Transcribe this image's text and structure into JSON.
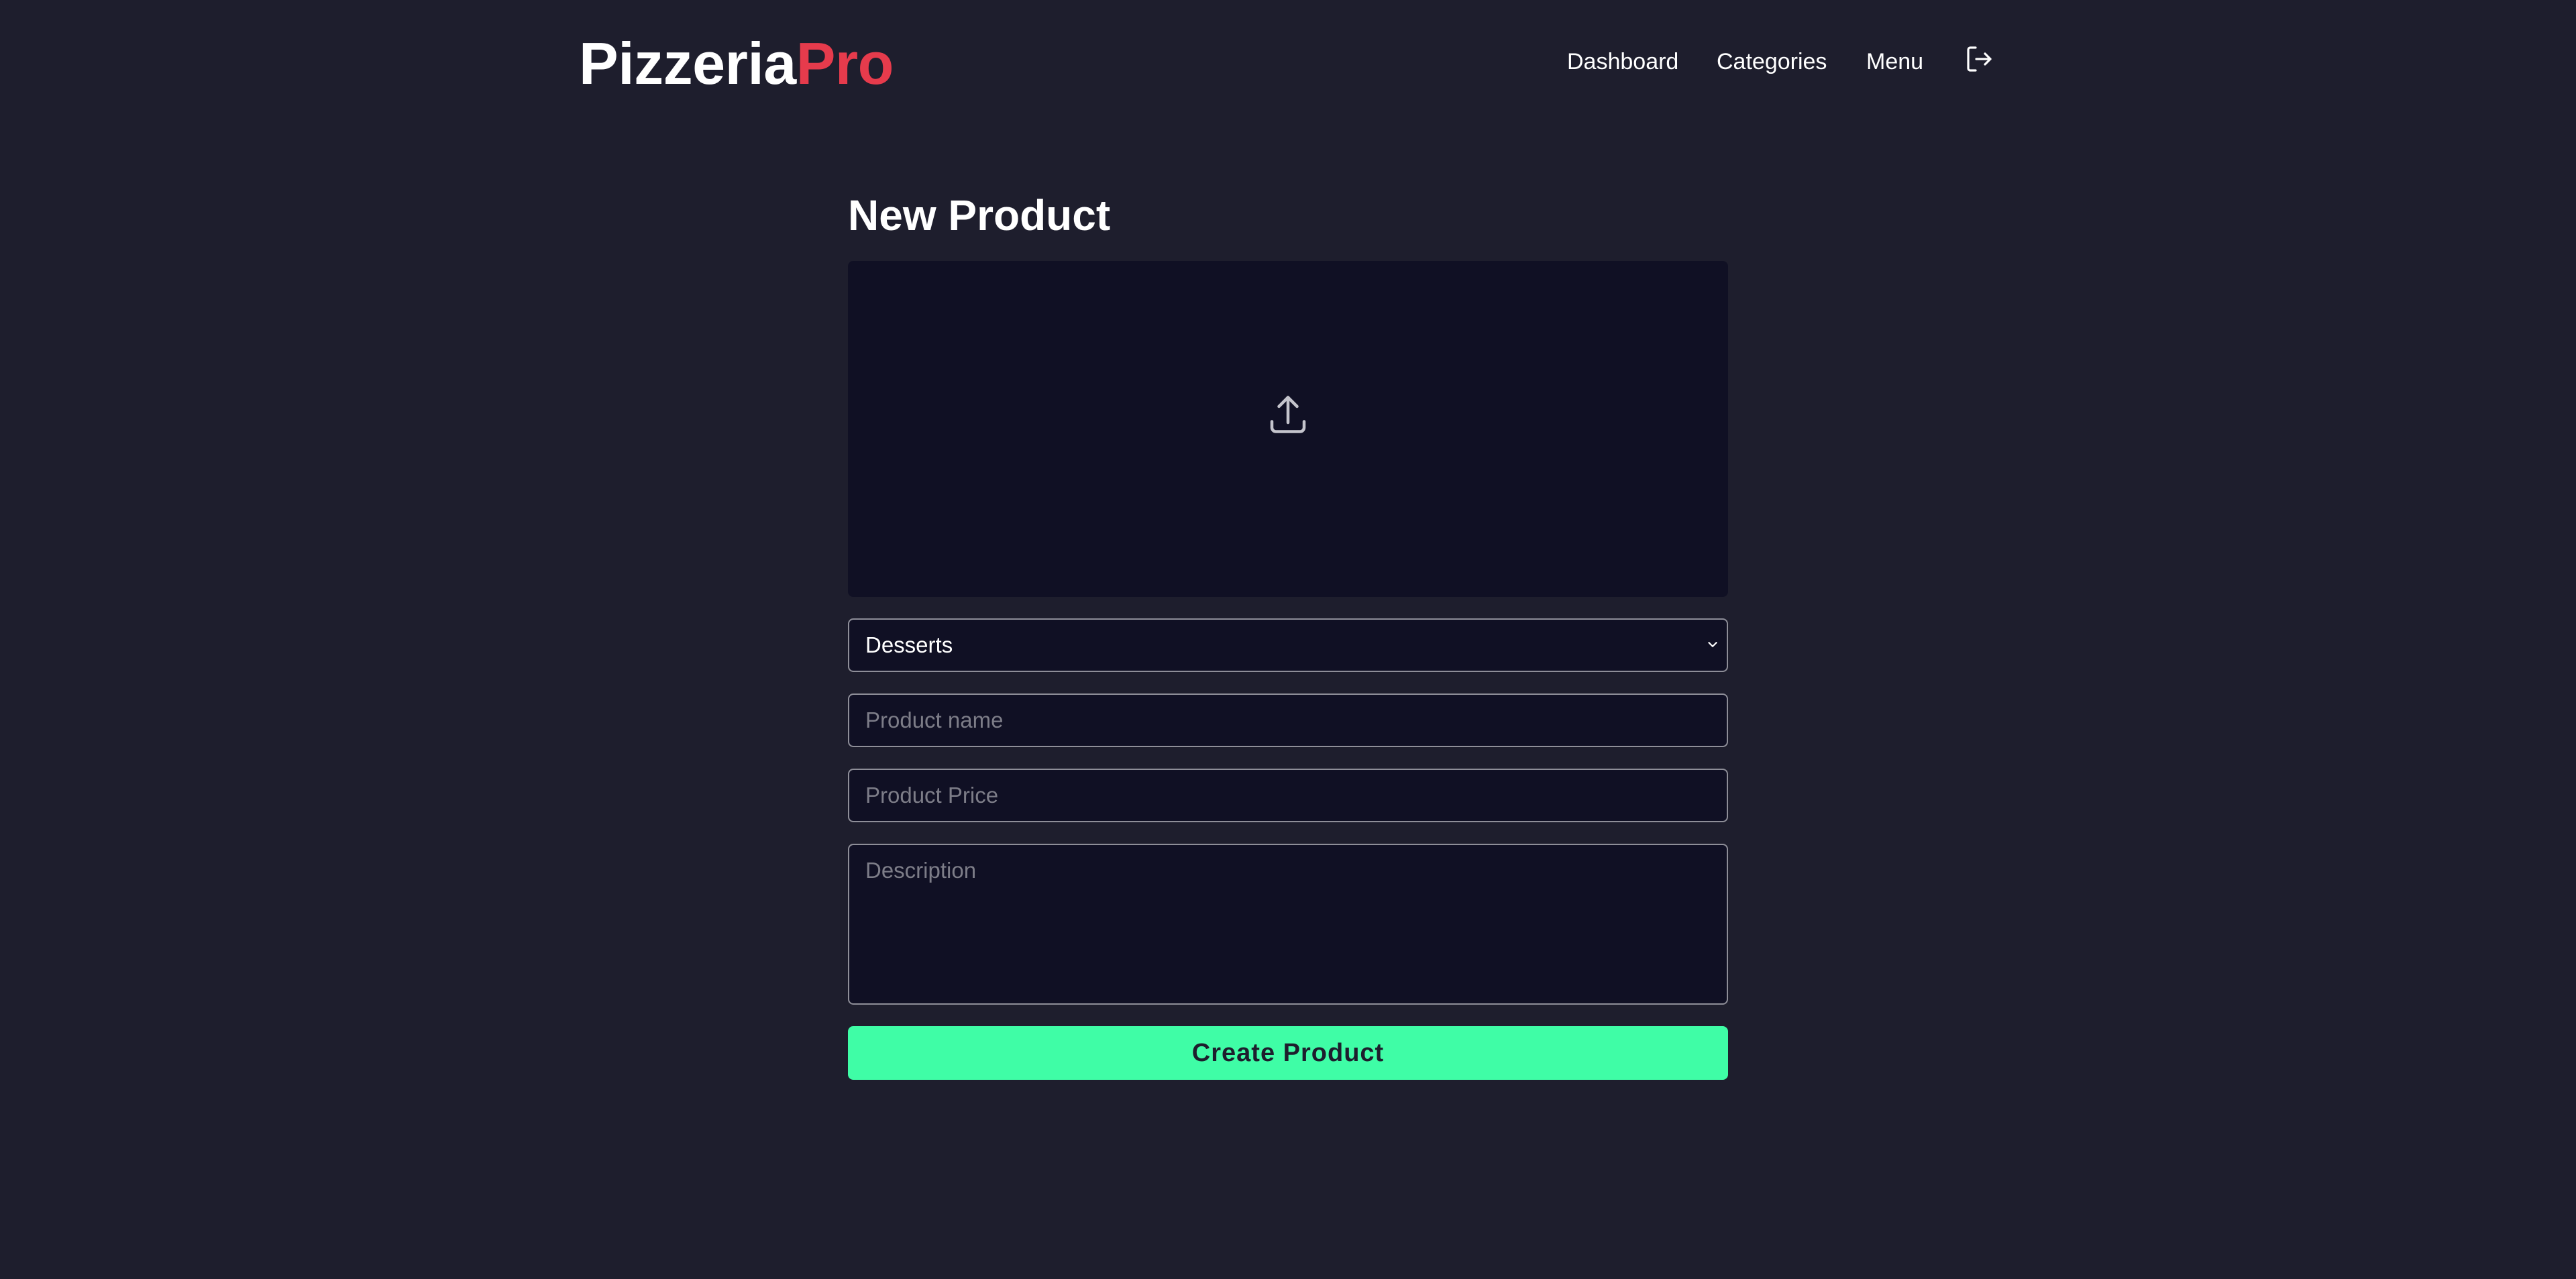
{
  "header": {
    "logo_main": "Pizzeria",
    "logo_accent": "Pro",
    "nav": {
      "dashboard": "Dashboard",
      "categories": "Categories",
      "menu": "Menu"
    },
    "logout_icon": "logout-icon"
  },
  "form": {
    "title": "New Product",
    "upload_icon": "upload-icon",
    "category_selected": "Desserts",
    "name_placeholder": "Product name",
    "price_placeholder": "Product Price",
    "description_placeholder": "Description",
    "submit_label": "Create Product"
  },
  "colors": {
    "background": "#1e1e2d",
    "panel": "#101024",
    "accent_red": "#e63b4c",
    "button_green": "#3ffda6"
  }
}
